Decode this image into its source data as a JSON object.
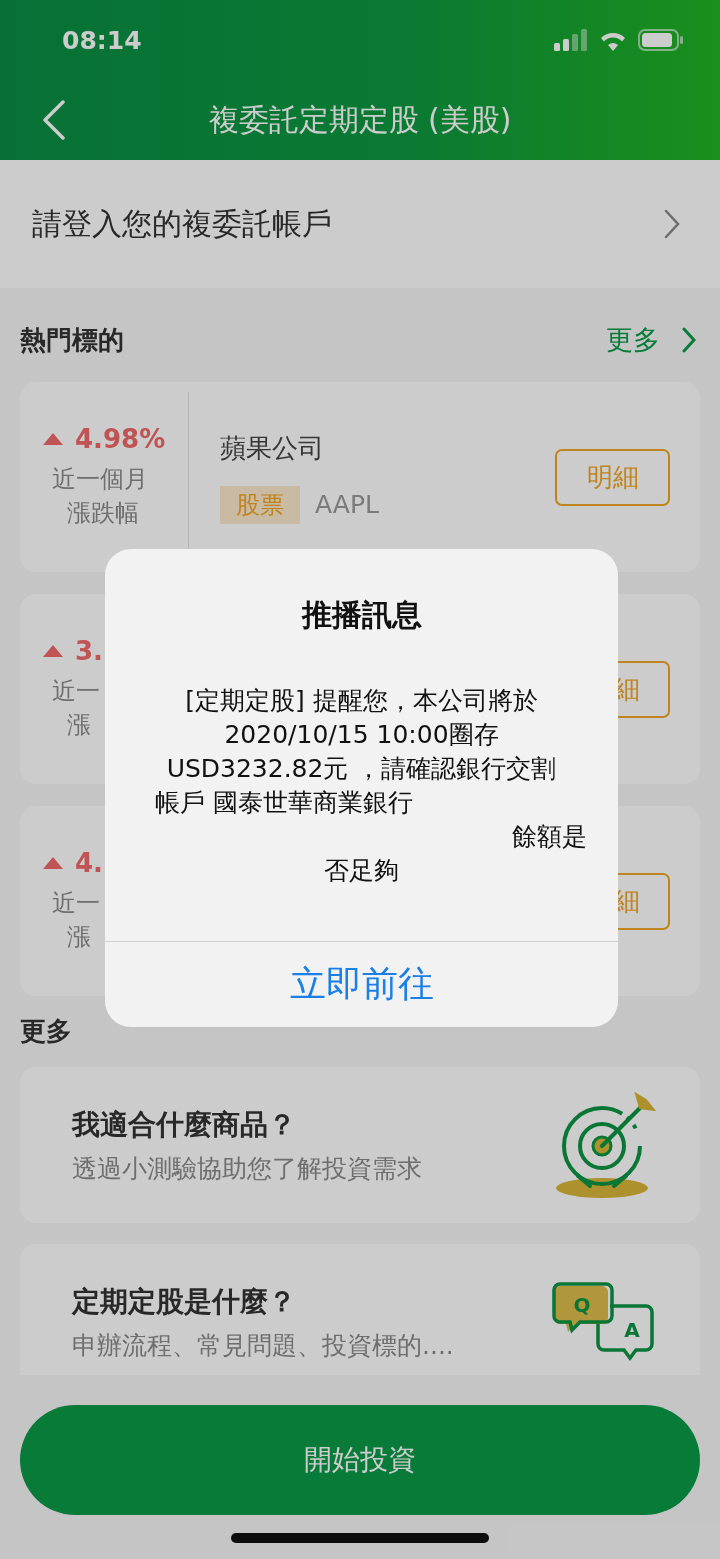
{
  "status_bar": {
    "time": "08:14"
  },
  "header": {
    "title": "複委託定期定股 (美股)"
  },
  "login_row": {
    "label": "請登入您的複委託帳戶"
  },
  "hot_section": {
    "title": "熱門標的",
    "more_link": "更多"
  },
  "stocks": [
    {
      "change": "4.98%",
      "period_lines": [
        "近一個月",
        "漲跌幅"
      ],
      "name": "蘋果公司",
      "tag": "股票",
      "symbol": "AAPL",
      "button": "明細"
    },
    {
      "change": "3.",
      "period_lines": [
        "近一",
        "漲"
      ],
      "button": "細"
    },
    {
      "change": "4.",
      "period_lines": [
        "近一",
        "漲"
      ],
      "button": "細"
    }
  ],
  "more_section": {
    "title": "更多"
  },
  "more_items": [
    {
      "kind": "target",
      "title": "我適合什麼商品？",
      "subtitle": "透過小測驗協助您了解投資需求"
    },
    {
      "kind": "qa",
      "title": "定期定股是什麼？",
      "subtitle": "申辦流程、常見問題、投資標的....",
      "icon_letters": [
        "Q",
        "A"
      ]
    }
  ],
  "start_button": "開始投資",
  "dialog": {
    "title": "推播訊息",
    "message_lines": [
      "[定期定股] 提醒您，本公司將於",
      "2020/10/15 10:00圈存",
      "USD3232.82元 ，請確認銀行交割",
      "帳戶 國泰世華商業銀行",
      "餘額是",
      "否足夠"
    ],
    "action": "立即前往"
  }
}
